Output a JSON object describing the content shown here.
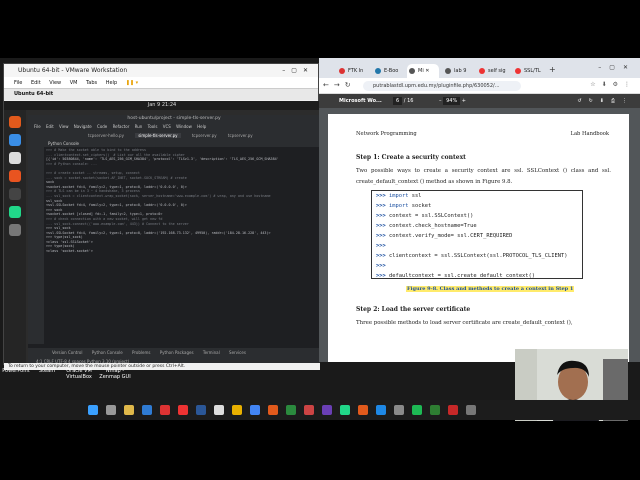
{
  "vmware": {
    "title": "Ubuntu 64-bit - VMware Workstation",
    "menu": [
      "File",
      "Edit",
      "View",
      "VM",
      "Tabs",
      "Help"
    ],
    "vm_tab": "Ubuntu 64-bit",
    "bottom_hint": "To return to your computer, move the mouse pointer outside or press Ctrl+Alt."
  },
  "ubuntu": {
    "clock": "Jan 9 21:24"
  },
  "ide": {
    "title": "host-ubuntu/project - simple-tls-server.py",
    "menu": [
      "File",
      "Edit",
      "View",
      "Navigate",
      "Code",
      "Refactor",
      "Run",
      "Tools",
      "VCS",
      "Window",
      "Help"
    ],
    "tabs": [
      "tcpserver-hello.py",
      "simple-tls-server.py",
      "tcpserver.py",
      "tcpserver.py"
    ],
    "active_tab": 1,
    "console_label": "Python Console",
    "code_lines": [
      ">>> # Make the socket able to bind to the address",
      "... clientcontext.set_ciphers()  # List our all the available cipher",
      "[{'id': 50380844, 'name': 'TLS_AES_256_GCM_SHA384', 'protocol': 'TLSv1.3', 'description': 'TLS_AES_256_GCM_SHA384'",
      ">>> # Python console: ...",
      "",
      ">>> # create socket -- streams, setup, connect",
      "... sock = socket.socket(socket.AF_INET, socket.SOCK_STREAM) # create",
      "sock",
      "<socket.socket fd=4, family=2, type=1, proto=0, laddr=('0.0.0.0', 0)>",
      ">>> # TLS can be in 3 ~ 4 handshake, 3 process",
      "... ssl_sock = clientcontext.wrap_socket(sock, server_hostname='www.example.com') # wrap, any and use hostname",
      "ssl_sock",
      "<ssl.SSLSocket fd=4, family=2, type=1, proto=0, laddr=('0.0.0.0', 0)>",
      ">>> sock",
      "<socket.socket [closed] fd=-1, family=2, type=1, proto=0>",
      ">>> # check connection with a new socket, will get new fd",
      "... ssl_sock.connect(('www.example.com', 443)) # Connect to the server",
      ">>> ssl_sock",
      "<ssl.SSLSocket fd=4, family=2, type=1, proto=0, laddr=('192.168.73.132', 49950), raddr=('184.28.16.228', 443)>",
      ">>> type(ssl_sock)",
      "<class 'ssl.SSLSocket'>",
      ">>> type(sock)",
      "<class 'socket.socket'>"
    ],
    "status": [
      "Version Control",
      "Python Console",
      "Problems",
      "Python Packages",
      "Terminal",
      "Services"
    ],
    "bottom": "4:1   CRLF   UTF-8   4 spaces   Python 3.10 (project)"
  },
  "desktop_icons": [
    "PowerPoint",
    "Steam",
    "Oracle VM VirtualBox",
    "Nmap - Zenmap GUI"
  ],
  "browser": {
    "tabs": [
      {
        "label": "FTK In",
        "color": "#d33"
      },
      {
        "label": "E-Boo",
        "color": "#27a"
      },
      {
        "label": "Mi",
        "color": "#555"
      },
      {
        "label": "lab 9",
        "color": "#555"
      },
      {
        "label": "self sig",
        "color": "#e33"
      },
      {
        "label": "SSL/TL",
        "color": "#e33"
      }
    ],
    "active_tab": 2,
    "url": "putrablastdl.upm.edu.my/pluginfile.php/630052/...",
    "pdf_title": "Microsoft Wo...",
    "page_current": "6",
    "page_total": "16",
    "zoom": "94%"
  },
  "document": {
    "header_left": "Network Programming",
    "header_right": "Lab Handbook",
    "step1_heading": "Step 1: Create a security context",
    "step1_text": "Two possible ways to create a security context are ssl. SSLContext () class and ssl. create_default_context () method as shown in Figure 9.8.",
    "code": [
      {
        "prompt": ">>>",
        "kw": "import",
        "rest": " ssl"
      },
      {
        "prompt": ">>>",
        "kw": "import",
        "rest": " socket"
      },
      {
        "prompt": ">>>",
        "kw": "",
        "rest": " context = ssl.SSLContext()"
      },
      {
        "prompt": ">>>",
        "kw": "",
        "rest": " context.check_hostname=True"
      },
      {
        "prompt": ">>>",
        "kw": "",
        "rest": " context.verify_mode= ssl.CERT_REQUIRED"
      },
      {
        "prompt": ">>>",
        "kw": "",
        "rest": ""
      },
      {
        "prompt": ">>>",
        "kw": "",
        "rest": " clientcontext = ssl.SSLContext(ssl.PROTOCOL_TLS_CLIENT)"
      },
      {
        "prompt": ">>>",
        "kw": "",
        "rest": ""
      },
      {
        "prompt": ">>>",
        "kw": "",
        "rest": " defaultcontext = ssl.create_default_context()"
      }
    ],
    "caption": "Figure 9-8.  Class and methods to create a context in Step 1",
    "step2_heading": "Step 2: Load the server certificate",
    "step2_text": "Three possible methods to load server certificate are create_default_context (),"
  }
}
